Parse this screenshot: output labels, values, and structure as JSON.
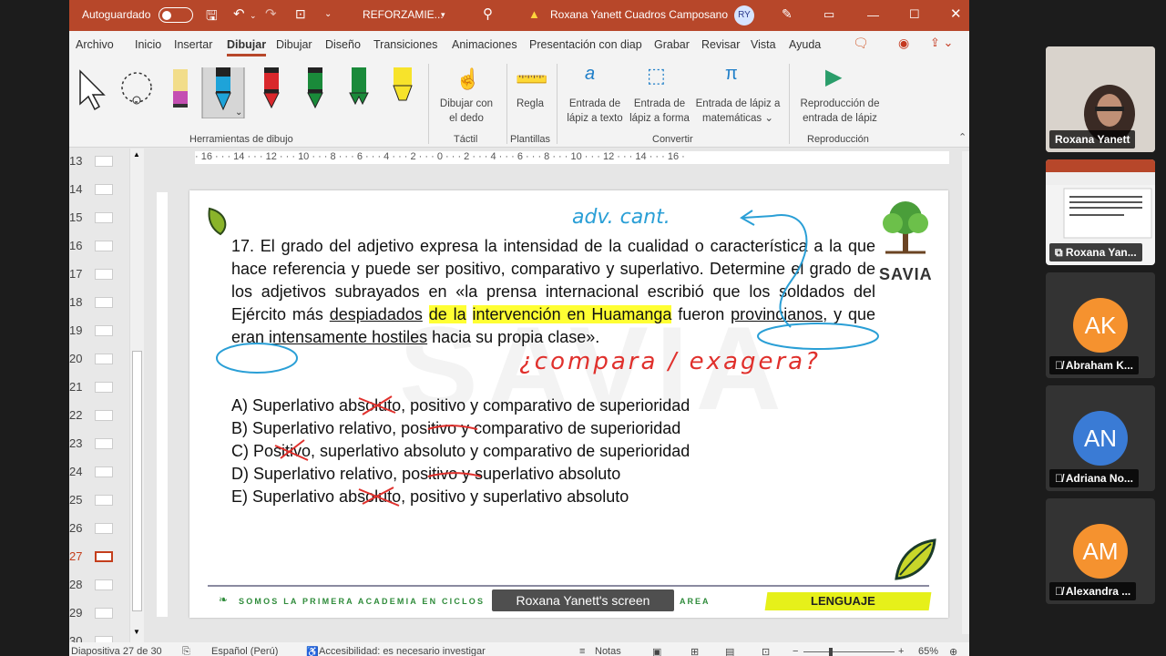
{
  "titlebar": {
    "autosave_label": "Autoguardado",
    "doc_title": "REFORZAMIE...",
    "user_name": "Roxana Yanett Cuadros Camposano",
    "user_initials": "RY"
  },
  "menu_tabs": [
    "Archivo",
    "Inicio",
    "Insertar",
    "Dibujar",
    "Dibujar",
    "Diseño",
    "Transiciones",
    "Animaciones",
    "Presentación con diap",
    "Grabar",
    "Revisar",
    "Vista",
    "Ayuda"
  ],
  "ribbon": {
    "group_drawing_tools": "Herramientas de dibujo",
    "draw_with_finger": [
      "Dibujar con",
      "el dedo"
    ],
    "group_touch": "Táctil",
    "ruler": "Regla",
    "group_templates": "Plantillas",
    "ink_to_text": [
      "Entrada de",
      "lápiz a texto"
    ],
    "ink_to_shape": [
      "Entrada de",
      "lápiz a forma"
    ],
    "ink_to_math": [
      "Entrada de lápiz a",
      "matemáticas ⌄"
    ],
    "group_convert": "Convertir",
    "ink_replay": [
      "Reproducción de",
      "entrada de lápiz"
    ],
    "group_replay": "Reproducción"
  },
  "slide_numbers": [
    "13",
    "14",
    "15",
    "16",
    "17",
    "18",
    "19",
    "20",
    "21",
    "22",
    "23",
    "24",
    "25",
    "26",
    "27",
    "28",
    "29",
    "30"
  ],
  "active_slide": "27",
  "ruler_text": "· 16 · · · 14 · · · 12 · · · 10 · · · 8 · · · 6 · · · 4 · · · 2 · · · 0 · · · 2 · · · 4 · · · 6 · · · 8 · · · 10 · · · 12 · · · 14 · · · 16 ·",
  "slide": {
    "question": {
      "p1": "17. El grado del adjetivo expresa la intensidad de la cualidad o característica a la que hace referencia y puede ser positivo, comparativo y superlativo. Determine el grado de los adjetivos subrayados en «la prensa internacional escribió que los soldados del Ejército más ",
      "u1": "despiadados",
      "p2": " ",
      "h1": "de la",
      "p3": " ",
      "h2": "intervención en Huamanga",
      "p4": " fueron ",
      "u2": "provincianos",
      "p5": ", y que eran ",
      "u3": "intensamente hostiles",
      "p6": " hacia su propia clase»."
    },
    "options": [
      "A) Superlativo absoluto, positivo y comparativo de superioridad",
      "B) Superlativo relativo, positivo y comparativo de superioridad",
      "C) Positivo, superlativo absoluto y comparativo de superioridad",
      "D) Superlativo relativo, positivo y superlativo absoluto",
      "E) Superlativo absoluto, positivo y superlativo absoluto"
    ],
    "logo_name": "SAVIA",
    "watermark": "SAVIA",
    "footer_text": "SOMOS LA PRIMERA ACADEMIA EN CICLOS",
    "footer_text_right": "AREA",
    "subject_badge": "LENGUAJE",
    "ink_note_top": "adv. cant.",
    "ink_note_mid": "¿compara / exagera?",
    "ink_color": "#2a9fd6",
    "ink_red": "#e0302c"
  },
  "share_caption": "Roxana Yanett's screen",
  "statusbar": {
    "slide_position": "Diapositiva 27 de 30",
    "language": "Español (Perú)",
    "accessibility": "Accesibilidad: es necesario investigar",
    "notes": "Notas",
    "zoom": "65%"
  },
  "participants": [
    {
      "name": "Roxana Yanett",
      "type": "video"
    },
    {
      "name": "Roxana Yan...",
      "type": "screen"
    },
    {
      "name": "Abraham K...",
      "initials": "AK",
      "color": "#f5922f",
      "muted": true
    },
    {
      "name": "Adriana No...",
      "initials": "AN",
      "color": "#3a7bd5",
      "muted": true
    },
    {
      "name": "Alexandra ...",
      "initials": "AM",
      "color": "#f5922f",
      "muted": true
    }
  ]
}
